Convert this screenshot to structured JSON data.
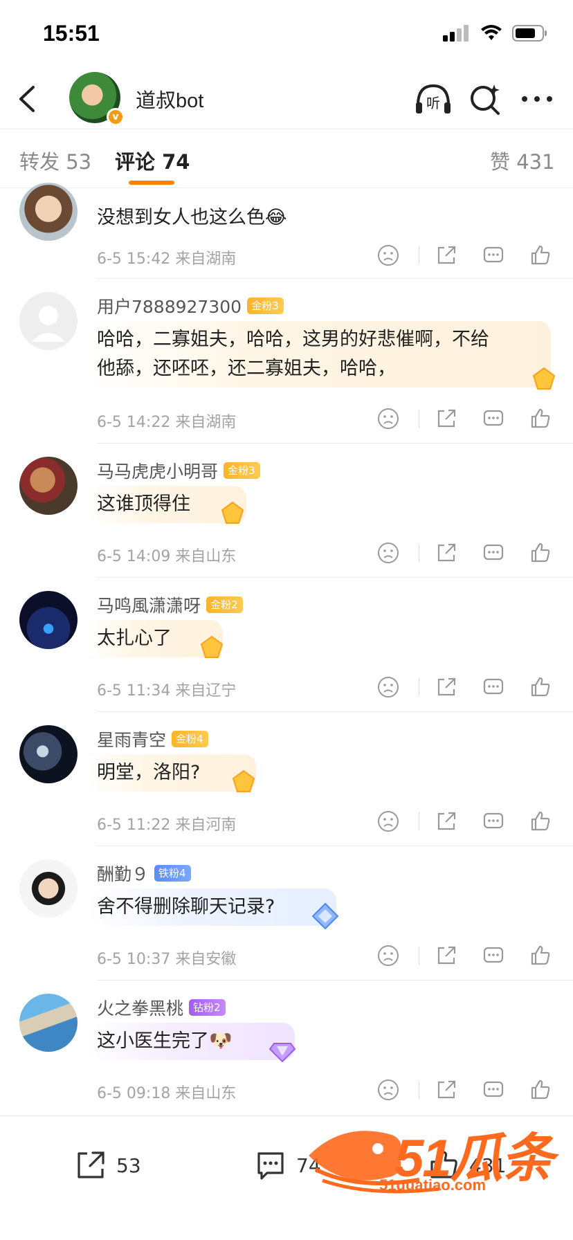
{
  "status_bar": {
    "time": "15:51"
  },
  "header": {
    "name": "道叔bot",
    "listen_label": "听"
  },
  "tabs": {
    "repost_label": "转发",
    "repost_count": "53",
    "comment_label": "评论",
    "comment_count": "74",
    "like_label": "赞",
    "like_count": "431"
  },
  "comments": [
    {
      "user": "",
      "badge": "",
      "text": "没想到女人也这么色",
      "emoji": "😂",
      "time": "6-5 15:42",
      "location": "来自湖南"
    },
    {
      "user": "用户7888927300",
      "badge": "金粉3",
      "text_line1": "哈哈，二寡姐夫，哈哈，这男的好悲催啊，不给",
      "text_line2": "他舔，还呸呸，还二寡姐夫，哈哈，",
      "time": "6-5 14:22",
      "location": "来自湖南"
    },
    {
      "user": "马马虎虎小明哥",
      "badge": "金粉3",
      "text": "这谁顶得住",
      "time": "6-5 14:09",
      "location": "来自山东"
    },
    {
      "user": "马鸣風潇潇呀",
      "badge": "金粉2",
      "text": "太扎心了",
      "time": "6-5 11:34",
      "location": "来自辽宁"
    },
    {
      "user": "星雨青空",
      "badge": "金粉4",
      "text": "明堂，洛阳?",
      "time": "6-5 11:22",
      "location": "来自河南"
    },
    {
      "user": "酬勤９",
      "badge": "铁粉4",
      "text": "舍不得删除聊天记录?",
      "time": "6-5 10:37",
      "location": "来自安徽"
    },
    {
      "user": "火之拳黑桃",
      "badge": "钻粉2",
      "text": "这小医生完了",
      "emoji": "🐶",
      "time": "6-5 09:18",
      "location": "来自山东"
    }
  ],
  "bottom_bar": {
    "repost_count": "53",
    "comment_count": "74",
    "like_count": "431"
  },
  "watermark": {
    "brand": "51瓜条",
    "url": "51guatiao.com"
  },
  "colors": {
    "accent": "#ff8200",
    "watermark": "#ff6a1f",
    "gold_badge": "#ffb22b",
    "iron_badge": "#5b8df7",
    "diamond_badge": "#a25cf2"
  }
}
